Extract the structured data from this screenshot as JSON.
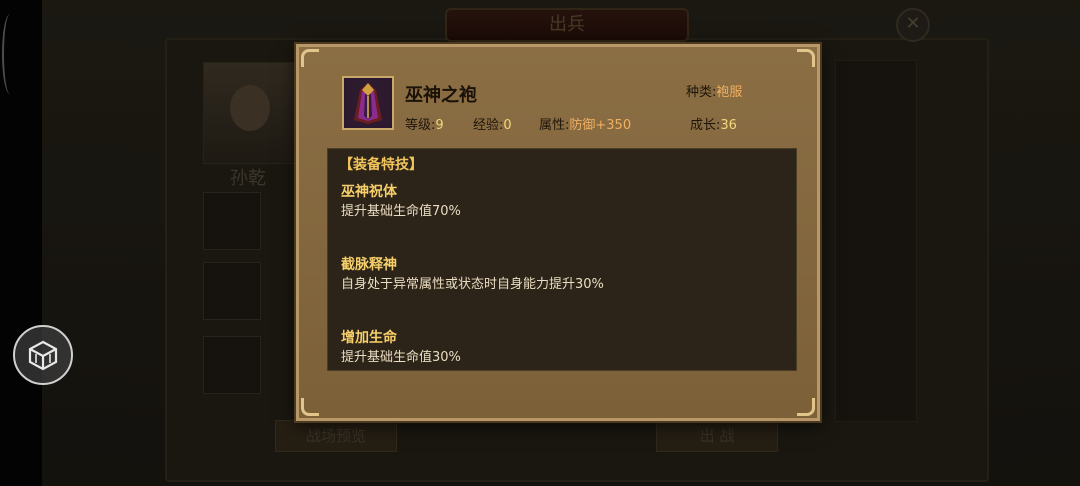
{
  "background": {
    "window_title": "出兵",
    "close_icon": "close-icon",
    "hero_name": "孙乾",
    "button_left": "战场预览",
    "button_right": "出 战"
  },
  "item": {
    "icon": "robe-icon",
    "name": "巫神之袍",
    "category_label": "种类:",
    "category_value": "袍服",
    "level_label": "等级:",
    "level_value": "9",
    "exp_label": "经验:",
    "exp_value": "0",
    "attr_label": "属性:",
    "attr_value": "防御+350",
    "growth_label": "成长:",
    "growth_value": "36"
  },
  "skills": {
    "header": "【装备特技】",
    "list": [
      {
        "title": "巫神祝体",
        "desc": "提升基础生命值70%"
      },
      {
        "title": "截脉释神",
        "desc": "自身处于异常属性或状态时自身能力提升30%"
      },
      {
        "title": "增加生命",
        "desc": "提升基础生命值30%"
      }
    ]
  },
  "colors": {
    "dialog_bg": "#84683e",
    "skill_title": "#f6cf6a",
    "value_highlight": "#f3d77a",
    "attr_highlight": "#f0b060"
  }
}
